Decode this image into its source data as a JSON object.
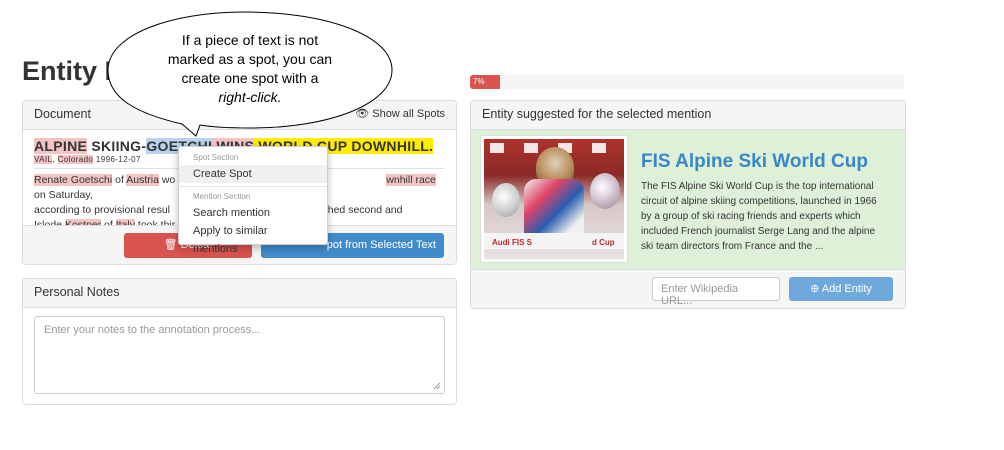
{
  "app_title": "Entity Li",
  "callout": {
    "line1": "If a piece of text is not",
    "line2": "marked as a spot, you can",
    "line3": "create one spot with a",
    "line4": "right-click."
  },
  "progress": {
    "label": "7%",
    "value": 0.07
  },
  "document": {
    "header": "Document",
    "show_all": "Show all Spots",
    "headline": {
      "w1": "ALPINE",
      "w2": " SKIING-",
      "w3": "GOETC",
      "w3b": "HI",
      "w4": " WINS",
      "w5": " WORLD CUP DOWNHILL."
    },
    "sub": {
      "place1": "VAIL",
      "sep": ", ",
      "place2": "Colorado",
      "date": " 1996-12-07"
    },
    "body": {
      "p1": "Renate Goetschi",
      "p2": " of ",
      "p3": "Austria",
      "p4": " wo",
      "p5": "wnhill race",
      "p6": " on Saturday,",
      "l2a": "according to provisional resul",
      "l2b": "inished second and",
      "l3a": "Islode ",
      "l3b": "Kostner",
      "l3c": " of ",
      "l3d": "Italy",
      "l3e": " took thir"
    },
    "delete_label": "Delete",
    "create_spot_label": "pot from Selected Text"
  },
  "context_menu": {
    "spot_section": "Spot Section",
    "create_spot": "Create Spot",
    "mention_section": "Mention Section",
    "search_mention": "Search mention",
    "apply_similar": "Apply to similar mentions"
  },
  "notes": {
    "header": "Personal Notes",
    "placeholder": "Enter your notes to the annotation process..."
  },
  "entity": {
    "header": "Entity suggested for the selected mention",
    "title": "FIS Alpine Ski World Cup",
    "description_lines": [
      "The FIS Alpine Ski World Cup is the top international",
      "circuit of alpine skiing competitions, launched in 1966",
      "by a group of ski racing friends and experts which",
      "included French journalist Serge Lang and the alpine",
      "ski team directors from France and the ..."
    ],
    "image_caption": "Audi FIS S",
    "image_caption2": "d Cup",
    "url_placeholder": "Enter Wikipedia URL...",
    "add_label": "Add Entity"
  },
  "colors": {
    "primary": "#428bca",
    "danger": "#d9534f",
    "entity_bg": "#dff0d8",
    "title_blue": "#3a87c8"
  }
}
